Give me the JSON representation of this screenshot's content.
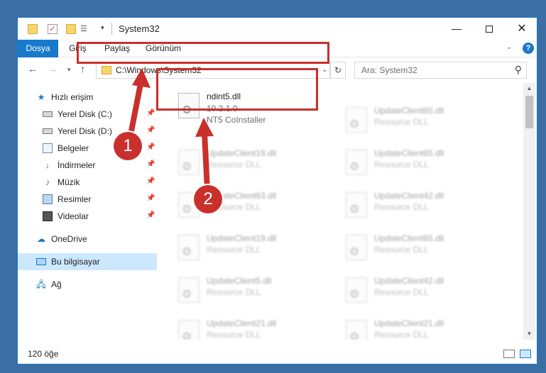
{
  "window": {
    "title": "System32",
    "controls": {
      "minimize": "—",
      "maximize": "",
      "close": "✕"
    }
  },
  "ribbon": {
    "tabs": [
      "Dosya",
      "Giriş",
      "Paylaş",
      "Görünüm"
    ]
  },
  "address": {
    "path": "C:\\Windows\\System32",
    "search_placeholder": "Ara: System32"
  },
  "navpane": {
    "quick_access": "Hızlı erişim",
    "items": [
      {
        "label": "Yerel Disk (C:)",
        "icon": "disk-icon",
        "pinned": true
      },
      {
        "label": "Yerel Disk (D:)",
        "icon": "disk-icon",
        "pinned": true
      },
      {
        "label": "Belgeler",
        "icon": "documents-icon",
        "pinned": true
      },
      {
        "label": "İndirmeler",
        "icon": "download-icon",
        "pinned": true
      },
      {
        "label": "Müzik",
        "icon": "music-icon",
        "pinned": true
      },
      {
        "label": "Resimler",
        "icon": "pictures-icon",
        "pinned": true
      },
      {
        "label": "Videolar",
        "icon": "video-icon",
        "pinned": true
      }
    ],
    "onedrive": "OneDrive",
    "this_pc": "Bu bilgisayar",
    "network": "Ağ"
  },
  "files": {
    "highlighted": {
      "name": "ndint5.dll",
      "version": "10.2.1.0",
      "description": "NT5 CoInstaller"
    },
    "left_column": [
      {
        "name": "UpdateClient19.dll",
        "type": "Resource DLL"
      },
      {
        "name": "UpdateClient63.dll",
        "type": "Resource DLL"
      },
      {
        "name": "UpdateClient19.dll",
        "type": "Resource DLL"
      },
      {
        "name": "UpdateClient5.dll",
        "type": "Resource DLL"
      },
      {
        "name": "UpdateClient21.dll",
        "type": "Resource DLL"
      }
    ],
    "right_column": [
      {
        "name": "UpdateClient65.dll",
        "type": "Resource DLL"
      },
      {
        "name": "UpdateClient65.dll",
        "type": "Resource DLL"
      },
      {
        "name": "UpdateClient42.dll",
        "type": "Resource DLL"
      },
      {
        "name": "UpdateClient65.dll",
        "type": "Resource DLL"
      },
      {
        "name": "UpdateClient42.dll",
        "type": "Resource DLL"
      },
      {
        "name": "UpdateClient21.dll",
        "type": "Resource DLL"
      }
    ]
  },
  "status": {
    "count": "120 öğe"
  },
  "annotations": {
    "step1": "1",
    "step2": "2"
  },
  "colors": {
    "accent": "#1979ca",
    "annotation": "#c9302c",
    "selection": "#cce8ff"
  }
}
